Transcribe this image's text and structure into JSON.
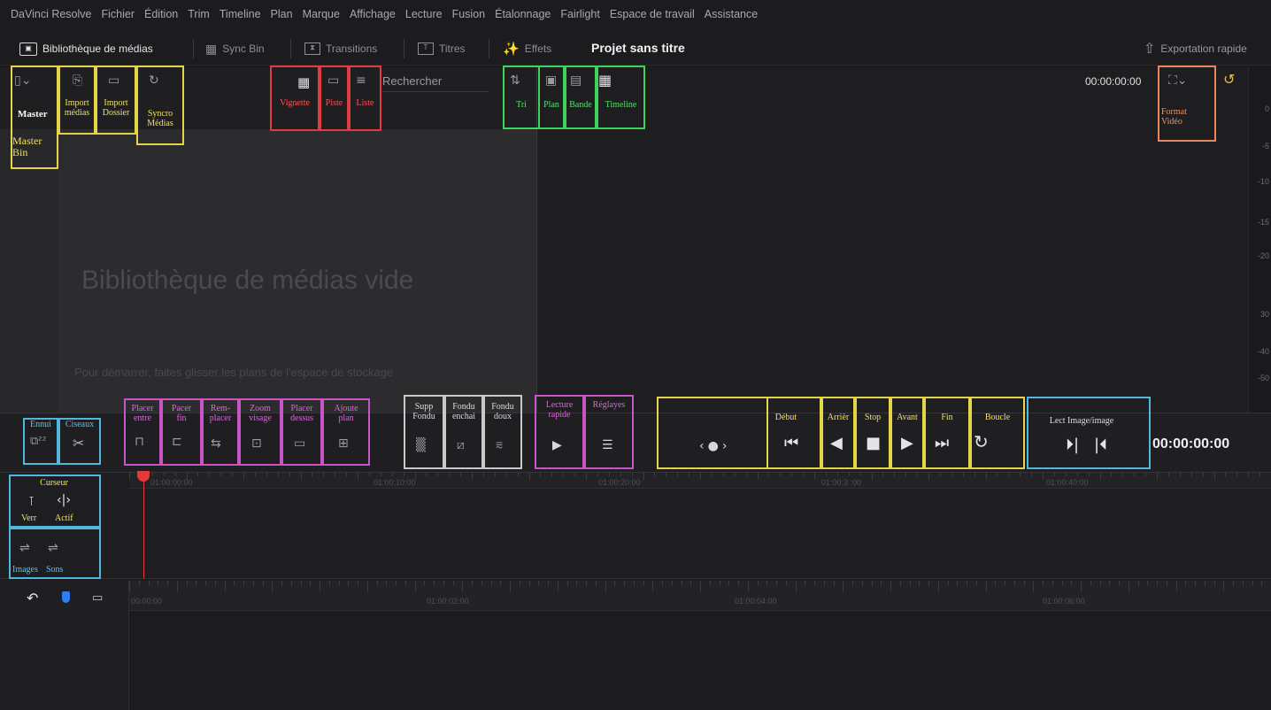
{
  "menu": [
    "DaVinci Resolve",
    "Fichier",
    "Édition",
    "Trim",
    "Timeline",
    "Plan",
    "Marque",
    "Affichage",
    "Lecture",
    "Fusion",
    "Étalonnage",
    "Fairlight",
    "Espace de travail",
    "Assistance"
  ],
  "toolbar": {
    "media_pool": "Bibliothèque de médias",
    "sync_bin": "Sync Bin",
    "transitions": "Transitions",
    "titles": "Titres",
    "effects": "Effets",
    "project_title": "Projet sans titre",
    "quick_export": "Exportation rapide"
  },
  "pool": {
    "search_placeholder": "Rechercher",
    "empty_title": "Bibliothèque de médias vide",
    "empty_hint": "Pour démarrer, faites glisser les plans de l'espace de stockage",
    "master_bin": "Master"
  },
  "viewer": {
    "timecode": "00:00:00:00",
    "scale": [
      "0",
      "-5",
      "-10",
      "-15",
      "-20",
      "30",
      "-40",
      "-50"
    ]
  },
  "annotations": {
    "master": "Master",
    "master_bin": "Master\nBin",
    "import_medias": "Import\nmédias",
    "import_dossier": "Import\nDossier",
    "syncro_medias": "Syncro\nMédias",
    "vignette": "Vignette",
    "piste": "Piste",
    "liste": "Liste",
    "tri": "Tri",
    "plan": "Plan",
    "bande": "Bande",
    "timeline": "Timeline",
    "format_video": "Format\nVidéo",
    "ennui": "Ennui",
    "ciseaux": "Ciseaux",
    "placer_entre": "Placer\nentre",
    "placer_fin": "Pacer\nfin",
    "remplacer": "Rem-\nplacer",
    "zoom_visage": "Zoom\nvisage",
    "placer_dessus": "Placer\ndessus",
    "ajoute_plan": "Ajoute\nplan",
    "supp_fondu": "Supp\nFondu",
    "fondu_enchai": "Fondu\nenchai",
    "fondu_doux": "Fondu\ndoux",
    "lecture_rapide": "Lecture\nrapide",
    "reglages": "Réglayes",
    "debut": "Début",
    "arriere": "Arrièr",
    "stop": "Stop",
    "avant": "Avant",
    "fin": "Fin",
    "boucle": "Boucle",
    "lect_image": "Lect Image/image",
    "curseur": "Curseur",
    "verr": "Verr",
    "actif": "Actif",
    "images": "Images",
    "sons": "Sons"
  },
  "transport": {
    "timecode": "00:00:00:00"
  },
  "ruler_top": [
    "01:00:00:00",
    "01:00:10:00",
    "01:00:20:00",
    "01:00:3 :00",
    "01:00:40:00"
  ],
  "ruler_bottom": [
    "00:00:00",
    "01:00:02:00",
    "01:00:04:00",
    "01:00:06:00"
  ],
  "colors": {
    "bg": "#1c1c1e",
    "panel": "#2a2a2d",
    "playhead": "#e23a3a",
    "ann_yellow": "#e3d44a",
    "ann_red": "#e23a44",
    "ann_green": "#3fd35c",
    "ann_magenta": "#c855c8",
    "ann_blue": "#52b7de",
    "ann_orange": "#e8875a"
  },
  "icons": [
    "media-pool-icon",
    "sync-bin-icon",
    "transitions-icon",
    "titles-icon",
    "effects-wand-icon",
    "export-icon",
    "grid-icon",
    "sort-icon",
    "scissors-icon",
    "snooze-icon",
    "skip-start-icon",
    "reverse-icon",
    "stop-icon",
    "play-icon",
    "skip-end-icon",
    "loop-icon",
    "frame-forward-icon",
    "frame-back-icon"
  ]
}
